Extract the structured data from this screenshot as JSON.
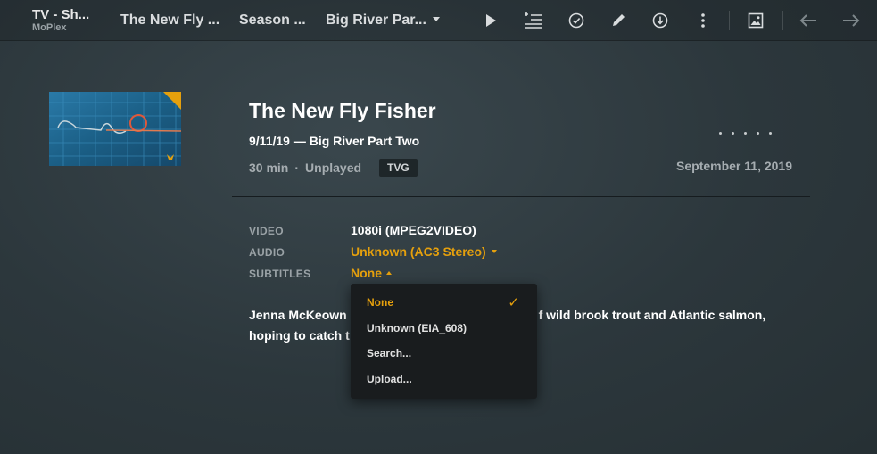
{
  "library": {
    "title": "TV - Sh...",
    "server": "MoPlex"
  },
  "breadcrumbs": [
    {
      "label": "The New Fly ..."
    },
    {
      "label": "Season ..."
    },
    {
      "label": "Big River Par..."
    }
  ],
  "toolbar": {
    "icons": [
      "play-icon",
      "add-to-queue-icon",
      "mark-watched-icon",
      "edit-icon",
      "download-icon",
      "more-icon",
      "artwork-icon",
      "back-arrow-icon",
      "forward-arrow-icon"
    ]
  },
  "episode": {
    "show_title": "The New Fly Fisher",
    "episode_title": "9/11/19 — Big River Part Two",
    "duration": "30 min",
    "status": "Unplayed",
    "content_rating": "TVG",
    "air_date": "September 11, 2019",
    "summary": "Jenna McKeown travels to the Big River in search of wild brook trout and Atlantic salmon, hoping to catch the ...",
    "summary_visible_line1a": "Jenna McKeown ",
    "summary_visible_line1b": "f wild brook trout and Atlantic salmon,",
    "summary_visible_line2": "hoping to catch t"
  },
  "media": {
    "video_label": "VIDEO",
    "video_value": "1080i (MPEG2VIDEO)",
    "audio_label": "AUDIO",
    "audio_value": "Unknown (AC3 Stereo)",
    "subtitles_label": "SUBTITLES",
    "subtitles_value": "None"
  },
  "subtitle_menu": {
    "items": [
      {
        "label": "None",
        "selected": true
      },
      {
        "label": "Unknown (EIA_608)",
        "selected": false
      },
      {
        "label": "Search...",
        "selected": false
      },
      {
        "label": "Upload...",
        "selected": false
      }
    ],
    "check_glyph": "✓"
  },
  "colors": {
    "accent": "#e5a00d",
    "background": "#2f3b40",
    "menu_bg": "#191c1e"
  }
}
